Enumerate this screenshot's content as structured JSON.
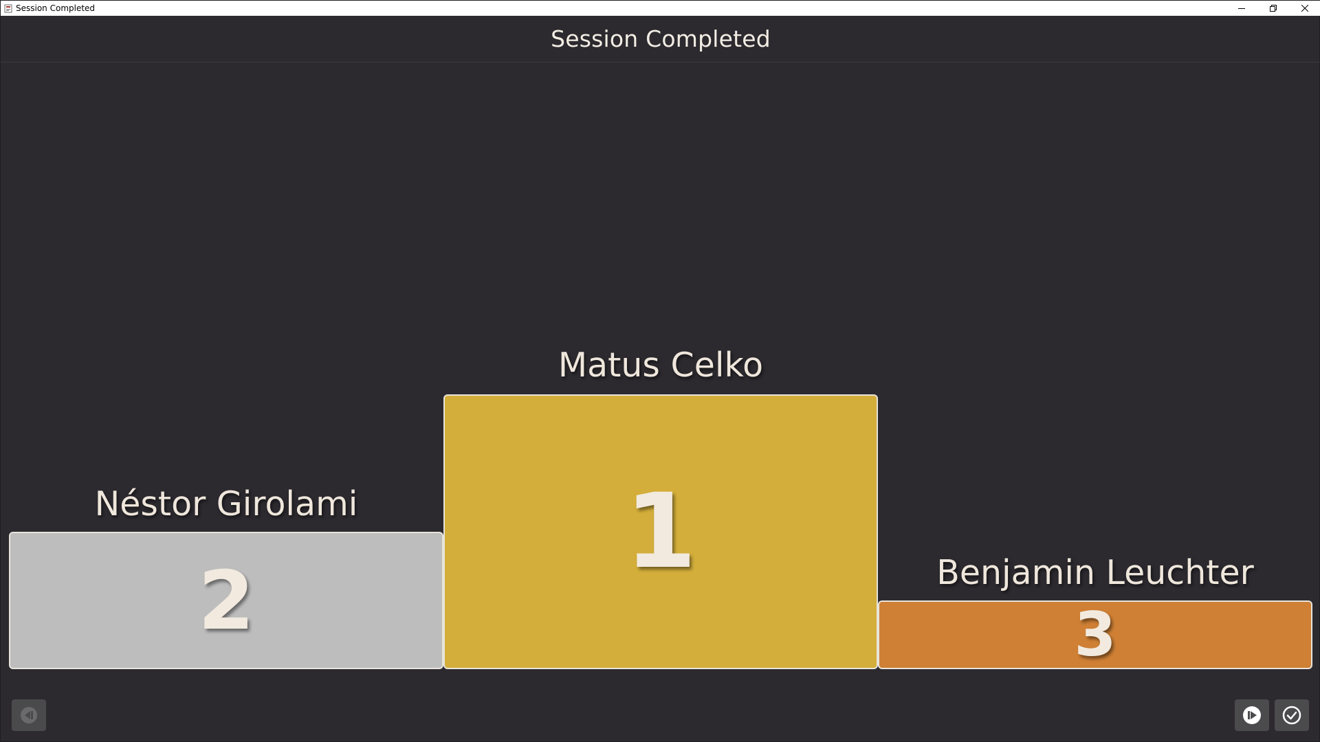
{
  "window": {
    "title": "Session Completed",
    "controls": {
      "minimize_icon": "minimize-icon",
      "maximize_icon": "restore-icon",
      "close_icon": "close-icon"
    }
  },
  "header": {
    "title": "Session Completed"
  },
  "podium": {
    "first": {
      "name": "Matus Celko",
      "rank": "1",
      "color": "#d3ae3a"
    },
    "second": {
      "name": "Néstor Girolami",
      "rank": "2",
      "color": "#bdbdbd"
    },
    "third": {
      "name": "Benjamin Leuchter",
      "rank": "3",
      "color": "#cf8035"
    }
  },
  "footer": {
    "previous_button_icon": "previous-icon",
    "next_button_icon": "play-next-icon",
    "confirm_button_icon": "check-circle-icon"
  }
}
